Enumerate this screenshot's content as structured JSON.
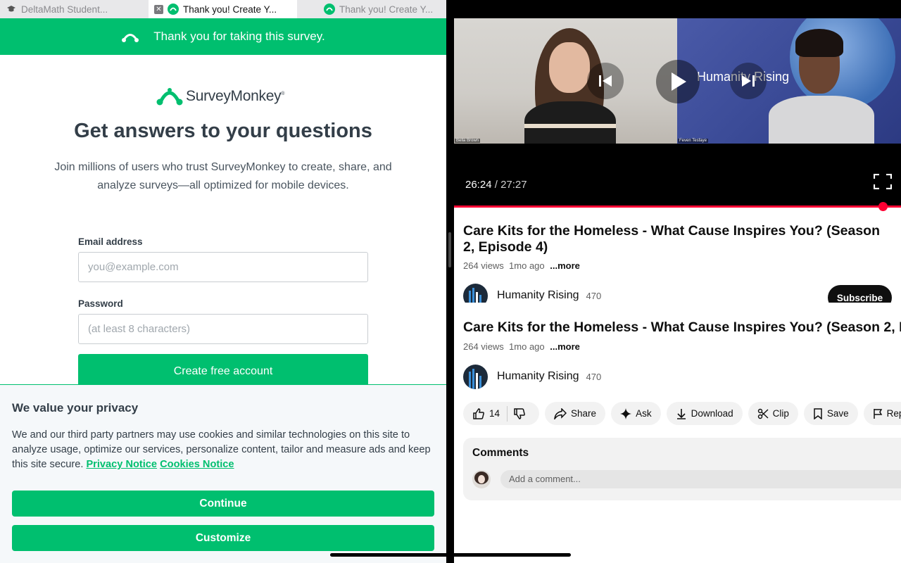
{
  "tabs": [
    {
      "title": "DeltaMath Student...",
      "active": false
    },
    {
      "title": "Thank you! Create Y...",
      "active": true
    },
    {
      "title": "Thank you! Create Y...",
      "active": false
    }
  ],
  "survey": {
    "banner": "Thank you for taking this survey.",
    "logo_text": "SurveyMonkey",
    "logo_mark": "®",
    "headline": "Get answers to your questions",
    "subhead": "Join millions of users who trust SurveyMonkey to create, share, and analyze surveys—all optimized for mobile devices.",
    "email_label": "Email address",
    "email_placeholder": "you@example.com",
    "password_label": "Password",
    "password_placeholder": "(at least 8 characters)",
    "create_button": "Create free account"
  },
  "privacy": {
    "title": "We value your privacy",
    "text": "We and our third party partners may use cookies and similar technologies on this site to analyze usage, optimize our services, personalize content, tailor and measure ads and keep this site secure.",
    "privacy_link": "Privacy Notice",
    "cookies_link": "Cookies Notice",
    "continue_button": "Continue",
    "customize_button": "Customize"
  },
  "video": {
    "current_time": "26:24",
    "separator": " / ",
    "duration": "27:27",
    "progress": 0.962,
    "left_name_tag": "Bella Brown",
    "right_name_tag": "Feven Tesfaye",
    "overlay_logo": "Humanity Rising",
    "title": "Care Kits for the Homeless - What Cause Inspires You? (Season 2, Episode 4)",
    "views": "264 views",
    "age": "1mo ago",
    "more": "...more",
    "channel": "Humanity Rising",
    "subscribers": "470",
    "subscribe_button": "Subscribe",
    "likes": "14",
    "actions": {
      "share": "Share",
      "ask": "Ask",
      "download": "Download",
      "clip": "Clip",
      "save": "Save",
      "report": "Report"
    },
    "comments_title": "Comments",
    "comment_placeholder": "Add a comment..."
  },
  "colors": {
    "surveymonkey_green": "#00bf6f",
    "youtube_red": "#ff0033",
    "text_dark": "#333e48"
  }
}
